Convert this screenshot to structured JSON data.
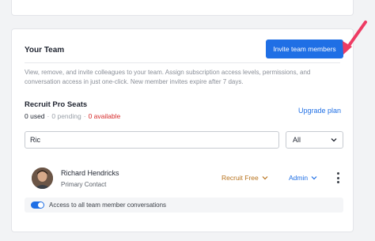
{
  "team": {
    "title": "Your Team",
    "invite_label": "Invite team members",
    "description": "View, remove, and invite colleagues to your team. Assign subscription access levels, permissions, and conversation access in just one-click. New member invites expire after 7 days."
  },
  "seats": {
    "title": "Recruit Pro Seats",
    "used": "0 used",
    "pending": "0 pending",
    "available": "0 available",
    "separator": "·",
    "upgrade_label": "Upgrade plan"
  },
  "filter": {
    "search_value": "Ric",
    "select_value": "All"
  },
  "member": {
    "name": "Richard Hendricks",
    "subtitle": "Primary Contact",
    "plan": "Recruit Free",
    "role": "Admin"
  },
  "access": {
    "label": "Access to all team member conversations",
    "enabled": true
  },
  "colors": {
    "accent": "#1f6fe5",
    "danger": "#d62a2a",
    "plan": "#b8731d",
    "arrow": "#ee3b63"
  },
  "icons": {
    "select_chevron": "chevron-down-icon",
    "plan_chevron": "chevron-down-icon",
    "role_chevron": "chevron-down-icon",
    "more": "more-vertical-icon",
    "pointer": "arrow-annotation-icon"
  }
}
